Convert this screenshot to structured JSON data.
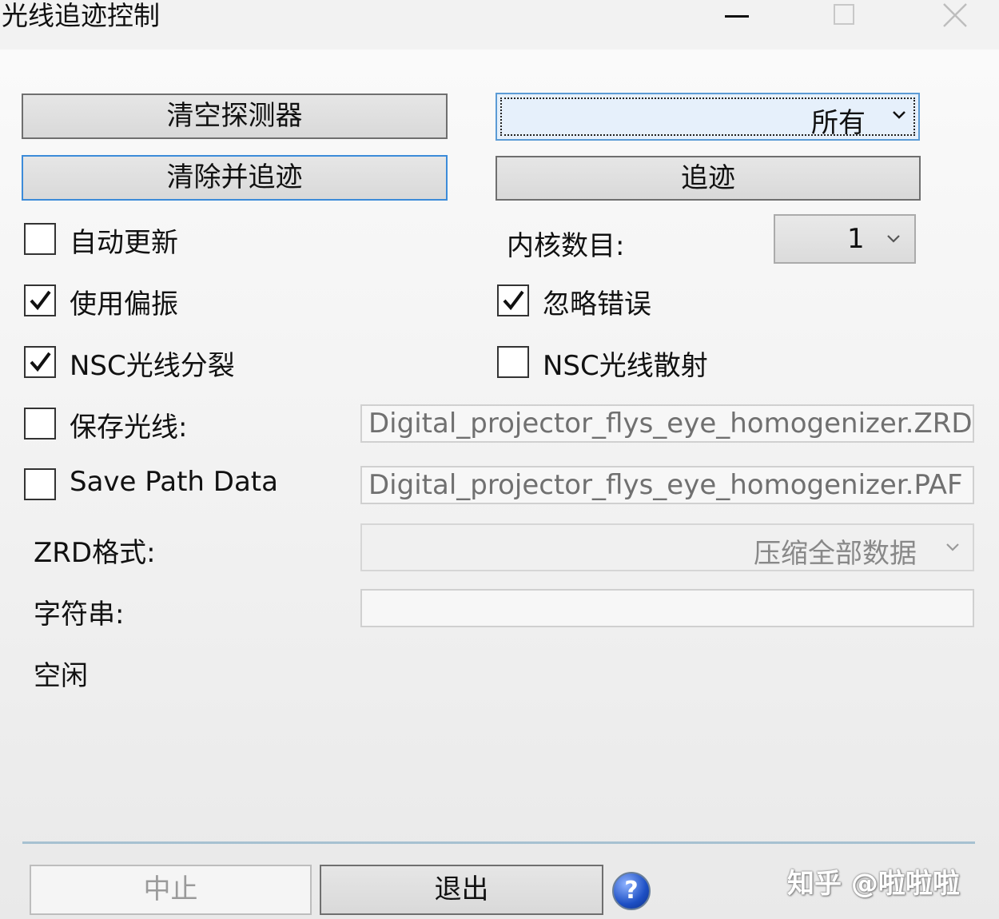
{
  "window": {
    "title": "光线追迹控制",
    "controls": {
      "minimize_icon": "minimize-icon",
      "maximize_icon": "maximize-icon",
      "close_icon": "close-icon"
    }
  },
  "buttons": {
    "clear_detectors": "清空探测器",
    "clear_and_trace": "清除并追迹",
    "trace": "追迹",
    "abort": "中止",
    "exit": "退出"
  },
  "detector_select": {
    "selected": "所有"
  },
  "core_count": {
    "label": "内核数目:",
    "selected": "1"
  },
  "checkboxes": {
    "auto_update": {
      "label": "自动更新",
      "checked": false
    },
    "use_polarization": {
      "label": "使用偏振",
      "checked": true
    },
    "ignore_errors": {
      "label": "忽略错误",
      "checked": true
    },
    "nsc_ray_split": {
      "label": "NSC光线分裂",
      "checked": true
    },
    "nsc_ray_scatter": {
      "label": "NSC光线散射",
      "checked": false
    },
    "save_rays": {
      "label": "保存光线:",
      "checked": false
    },
    "save_path_data": {
      "label": "Save Path Data",
      "checked": false
    }
  },
  "fields": {
    "zrd_file": "Digital_projector_flys_eye_homogenizer.ZRD",
    "paf_file": "Digital_projector_flys_eye_homogenizer.PAF",
    "zrd_format_label": "ZRD格式:",
    "zrd_format_value": "压缩全部数据",
    "filter_label": "字符串:",
    "filter_value": ""
  },
  "status": "空闲",
  "help": {
    "glyph": "?",
    "icon": "help-icon"
  },
  "watermark": "知乎 @啦啦啦",
  "colors": {
    "focus_border": "#3c8bd9",
    "divider": "#a7c1d1",
    "disabled_text": "#9a9a9a"
  }
}
